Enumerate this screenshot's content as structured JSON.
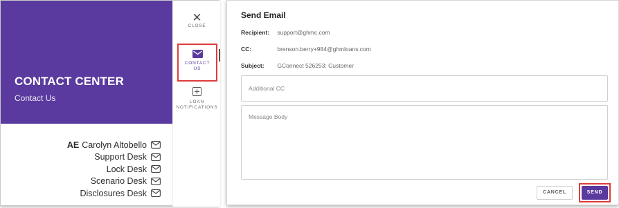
{
  "left": {
    "banner_title": "CONTACT CENTER",
    "banner_subtitle": "Contact Us",
    "contacts": [
      {
        "abbr": "AE",
        "name": "Carolyn Altobello"
      },
      {
        "abbr": "",
        "name": "Support Desk"
      },
      {
        "abbr": "",
        "name": "Lock Desk"
      },
      {
        "abbr": "",
        "name": "Scenario Desk"
      },
      {
        "abbr": "",
        "name": "Disclosures Desk"
      }
    ]
  },
  "rail": {
    "close_label": "CLOSE",
    "contact_label_1": "CONTACT",
    "contact_label_2": "US",
    "loan_label_1": "LOAN",
    "loan_label_2": "NOTIFICATIONS"
  },
  "email": {
    "title": "Send Email",
    "recipient_label": "Recipient:",
    "recipient_value": "support@ghmc.com",
    "cc_label": "CC:",
    "cc_value": "brenson.berry+984@ghmloans.com",
    "subject_label": "Subject:",
    "subject_value": "GConnect 526253: Customer",
    "additional_cc_placeholder": "Additional CC",
    "message_placeholder": "Message Body",
    "cancel_label": "CANCEL",
    "send_label": "SEND"
  },
  "colors": {
    "brand_purple": "#5a3a9e",
    "highlight_red": "#e03a3a"
  },
  "icons": [
    "mail-icon",
    "close-icon",
    "plus-box-icon"
  ]
}
